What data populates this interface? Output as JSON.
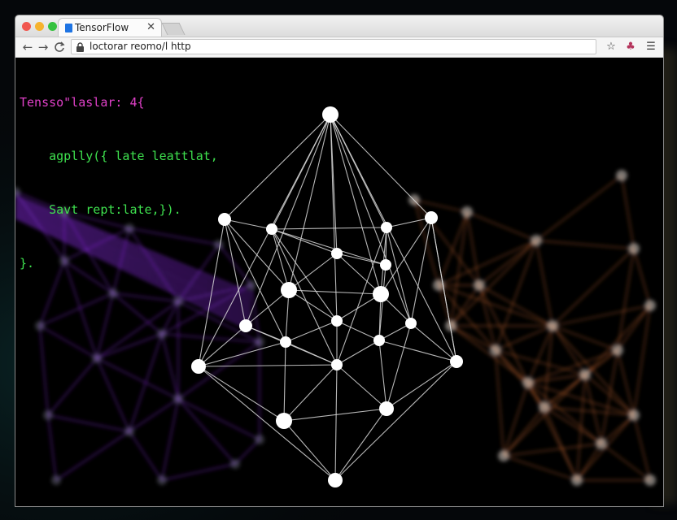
{
  "browser": {
    "tab_title": "TensorFlow",
    "url": "loctorar reomo/l http"
  },
  "icons": {
    "back": "back-arrow-icon",
    "forward": "forward-arrow-icon",
    "reload": "reload-icon",
    "lock": "lock-icon",
    "bookmark": "star-icon",
    "extension": "extension-icon",
    "menu": "menu-icon"
  },
  "code": {
    "line1": "Tensso\"laslar: 4{",
    "line2": "    agplly({ late leattlat,",
    "line3": "    Savt rept:late,}).",
    "line4": "}."
  },
  "colors": {
    "code_magenta": "#e040c8",
    "code_green": "#3ee04e",
    "purple_network": "#8a2be2",
    "orange_network": "#c0622d",
    "node_white": "#ffffff"
  }
}
